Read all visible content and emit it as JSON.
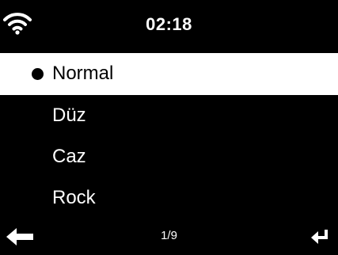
{
  "status_bar": {
    "time": "02:18",
    "wifi_icon": "wifi-icon"
  },
  "menu": {
    "items": [
      {
        "label": "Normal",
        "selected": true
      },
      {
        "label": "Düz",
        "selected": false
      },
      {
        "label": "Caz",
        "selected": false
      },
      {
        "label": "Rock",
        "selected": false
      }
    ]
  },
  "footer": {
    "page": "1/9",
    "back_icon": "left-arrow-icon",
    "enter_icon": "enter-return-icon"
  },
  "colors": {
    "background": "#000000",
    "foreground": "#ffffff",
    "selected_background": "#ffffff",
    "selected_text": "#000000"
  }
}
